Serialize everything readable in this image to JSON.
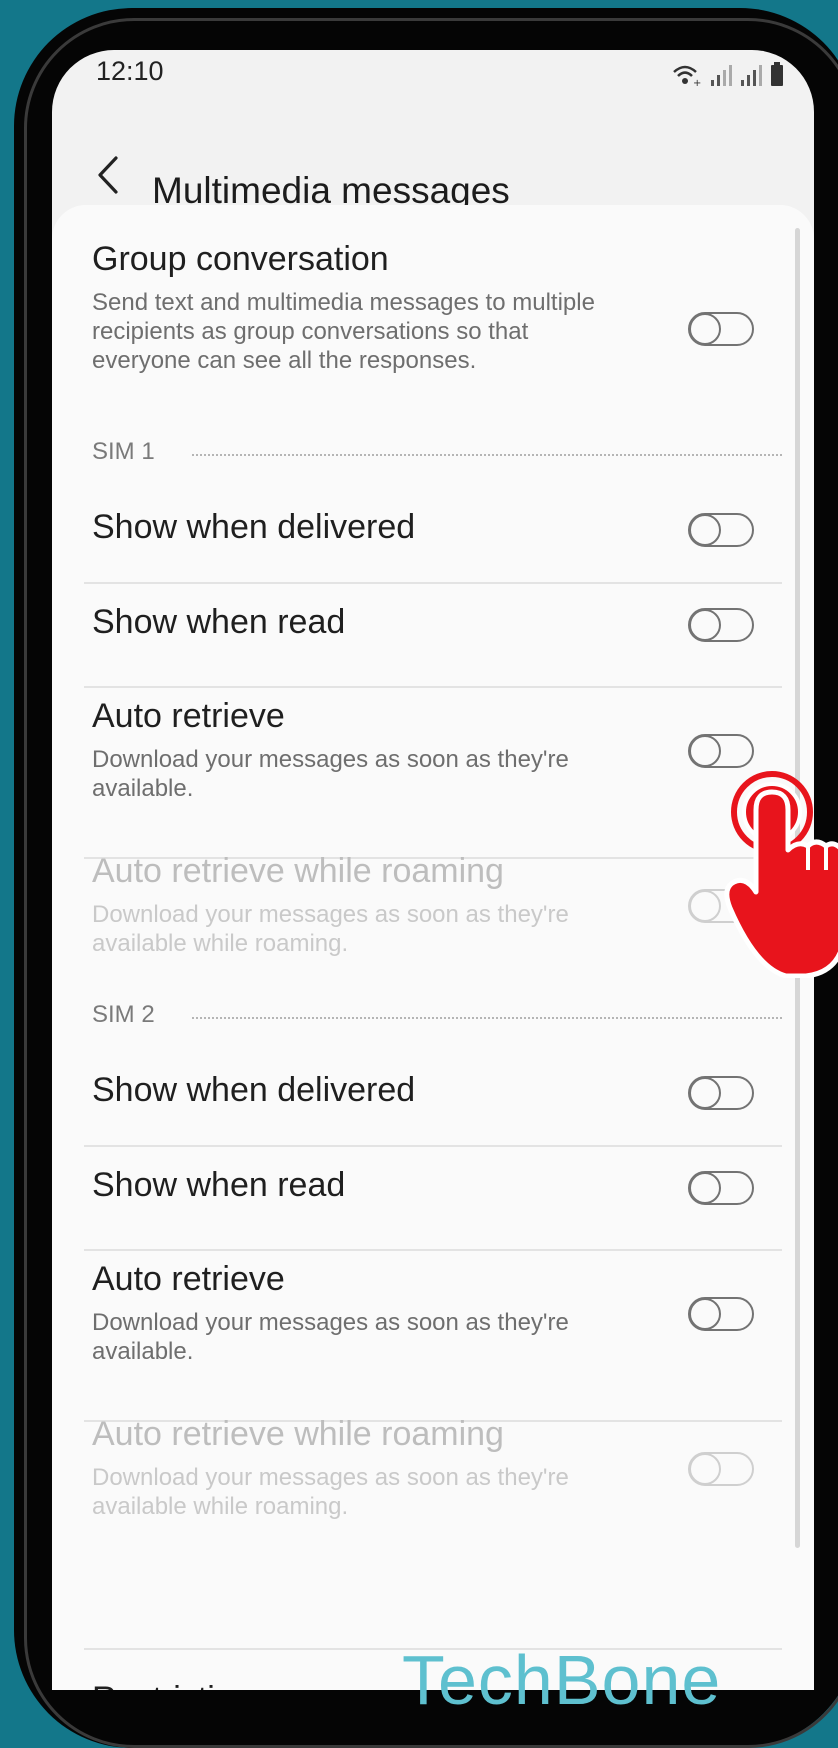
{
  "status_bar": {
    "time": "12:10",
    "icons": [
      "wifi-calling-icon",
      "signal-sim1-icon",
      "signal-sim2-icon",
      "battery-icon"
    ]
  },
  "app_bar": {
    "title": "Multimedia messages",
    "back_icon": "chevron-left-icon"
  },
  "group_conversation": {
    "title": "Group conversation",
    "description": "Send text and multimedia messages to multiple recipients as group conversations so that everyone can see all the responses.",
    "enabled": false
  },
  "sections": [
    {
      "label": "SIM 1",
      "items": [
        {
          "title": "Show when delivered",
          "description": "",
          "enabled": false,
          "disabled": false
        },
        {
          "title": "Show when read",
          "description": "",
          "enabled": false,
          "disabled": false
        },
        {
          "title": "Auto retrieve",
          "description": "Download your messages as soon as they're available.",
          "enabled": false,
          "disabled": false
        },
        {
          "title": "Auto retrieve while roaming",
          "description": "Download your messages as soon as they're available while roaming.",
          "enabled": false,
          "disabled": true
        }
      ]
    },
    {
      "label": "SIM 2",
      "items": [
        {
          "title": "Show when delivered",
          "description": "",
          "enabled": false,
          "disabled": false
        },
        {
          "title": "Show when read",
          "description": "",
          "enabled": false,
          "disabled": false
        },
        {
          "title": "Auto retrieve",
          "description": "Download your messages as soon as they're available.",
          "enabled": false,
          "disabled": false
        },
        {
          "title": "Auto retrieve while roaming",
          "description": "Download your messages as soon as they're available while roaming.",
          "enabled": false,
          "disabled": true
        }
      ]
    }
  ],
  "partial_item": "Restrictions",
  "watermark": "TechBone",
  "colors": {
    "background": "#13778a",
    "pointer": "#e8141c",
    "watermark": "#5ec0cf"
  }
}
